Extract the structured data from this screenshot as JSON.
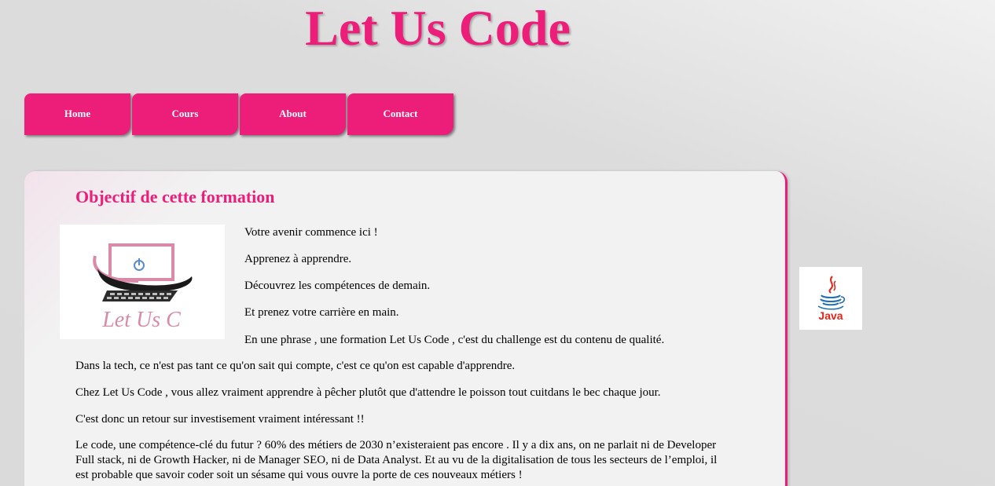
{
  "site": {
    "title": "Let Us Code"
  },
  "nav": {
    "items": [
      {
        "label": "Home"
      },
      {
        "label": "Cours"
      },
      {
        "label": "About"
      },
      {
        "label": "Contact"
      }
    ]
  },
  "main": {
    "section_title": "Objectif de cette formation",
    "logo_text": "Let Us C",
    "paragraphs": [
      "Votre avenir commence ici !",
      "Apprenez à apprendre.",
      "Découvrez les compétences de demain.",
      "Et prenez votre carrière en main.",
      "En une phrase , une formation Let Us Code , c'est du challenge est du contenu de qualité.",
      "Dans la tech, ce n'est pas tant ce qu'on sait qui compte, c'est ce qu'on est capable d'apprendre.",
      "Chez Let Us Code , vous allez vraiment apprendre à pêcher plutôt que d'attendre le poisson tout cuitdans le bec chaque jour.",
      "C'est donc un retour sur investisement vraiment intéressant !!",
      "Le code, une compétence-clé du futur ? 60% des métiers de 2030 n’existeraient pas encore . Il y a dix ans, on ne parlait ni de Developer Full stack, ni de Growth Hacker, ni de Manager SEO, ni de Data Analyst. Et au vu de la digitalisation de tous les secteurs de l’emploi, il est probable que savoir coder soit un sésame qui vous ouvre la porte de ces nouveaux métiers !"
    ]
  },
  "aside": {
    "java_label": "Java"
  },
  "colors": {
    "accent": "#ed1e79",
    "background": "#dcdcdc",
    "panel": "#f2f2f2"
  }
}
